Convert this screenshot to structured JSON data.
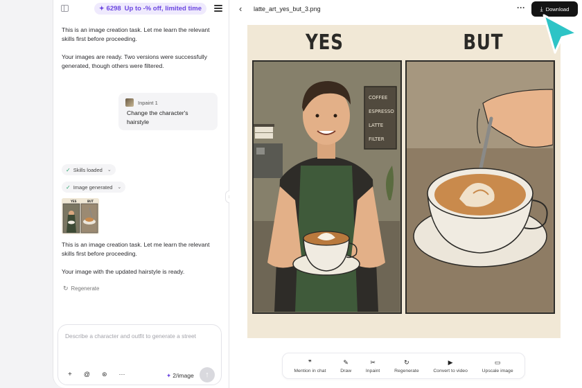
{
  "promo": {
    "credits": "6298",
    "offer": "Up to -% off, limited time"
  },
  "chat": {
    "msg1": "This is an image creation task. Let me learn the relevant skills first before proceeding.",
    "msg2": "Your images are ready. Two versions were successfully generated, though others were filtered.",
    "user": {
      "attachment_label": "Inpaint 1",
      "text": "Change the character's hairstyle"
    },
    "chip_skills": "Skills loaded",
    "chip_image": "Image generated",
    "thumb": {
      "yes": "YES",
      "but": "BUT"
    },
    "msg3": "This is an image creation task. Let me learn the relevant skills first before proceeding.",
    "msg4": "Your image with the updated hairstyle is ready.",
    "regenerate": "Regenerate"
  },
  "composer": {
    "placeholder": "Describe a character and outfit to generate a street",
    "tool_icons": [
      "plus-icon",
      "mention-icon",
      "openai-icon",
      "more-icon"
    ],
    "credits": "2/image"
  },
  "preview": {
    "file_name": "latte_art_yes_but_3.png",
    "download_label": "Download",
    "art": {
      "title_left": "YES",
      "title_right": "BUT",
      "menu": [
        "COFFEE",
        "ESPRESSO",
        "LATTE",
        "FILTER"
      ]
    },
    "tools": [
      {
        "label": "Mention in chat",
        "icon": "quote-icon"
      },
      {
        "label": "Draw",
        "icon": "pen-icon"
      },
      {
        "label": "Inpaint",
        "icon": "scissors-icon"
      },
      {
        "label": "Regenerate",
        "icon": "refresh-icon"
      },
      {
        "label": "Convert to video",
        "icon": "video-icon"
      },
      {
        "label": "Upscale image",
        "icon": "upscale-icon"
      }
    ]
  },
  "colors": {
    "accent": "#6b46e0",
    "cursor": "#2ec4c6",
    "art_bg": "#f1e8d6"
  }
}
